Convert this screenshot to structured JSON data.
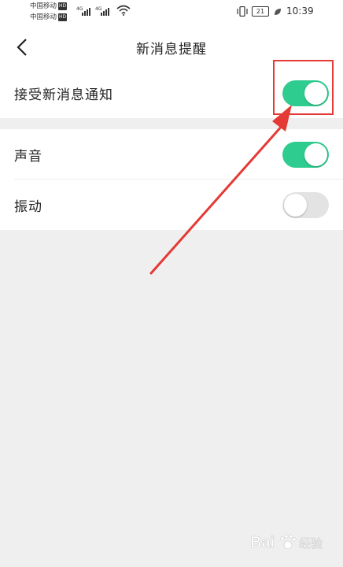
{
  "status_bar": {
    "carrier_1": "中国移动",
    "carrier_2": "中国移动",
    "hd_label": "HD",
    "network_1": "4G",
    "network_2": "4G",
    "battery_level": "21",
    "time": "10:39"
  },
  "header": {
    "title": "新消息提醒"
  },
  "settings": [
    {
      "label": "接受新消息通知",
      "enabled": true
    },
    {
      "label": "声音",
      "enabled": true
    },
    {
      "label": "振动",
      "enabled": false
    }
  ],
  "colors": {
    "toggle_on": "#2ecc8e",
    "toggle_off": "#e3e3e3",
    "annotation": "#e53935",
    "page_background": "#efefef"
  },
  "watermark": {
    "brand_1": "Bai",
    "brand_2": "经验"
  }
}
